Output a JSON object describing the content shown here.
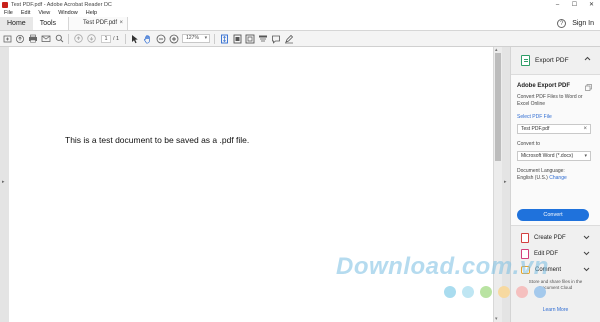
{
  "window": {
    "title": "Test PDF.pdf - Adobe Acrobat Reader DC",
    "controls": [
      "–",
      "☐",
      "✕"
    ]
  },
  "menu": [
    "File",
    "Edit",
    "View",
    "Window",
    "Help"
  ],
  "tabs": {
    "home": "Home",
    "tools": "Tools",
    "document": "Test PDF.pdf",
    "close": "×",
    "help": "?",
    "sign_in": "Sign In"
  },
  "toolbar": {
    "page_current": "1",
    "page_total": "/ 1",
    "zoom": "127%"
  },
  "document": {
    "text": "This is a test document to be saved as a .pdf file."
  },
  "panel": {
    "export_pdf": "Export PDF",
    "card_title": "Adobe Export PDF",
    "card_desc": "Convert PDF Files to Word or Excel Online",
    "select_file": "Select PDF File",
    "file_name": "Test PDF.pdf",
    "convert_to_label": "Convert to",
    "convert_to_value": "Microsoft Word (*.docx)",
    "doc_language_label": "Document Language:",
    "doc_language_value": "English (U.S.)",
    "change": "Change",
    "convert_button": "Convert",
    "create_pdf": "Create PDF",
    "edit_pdf": "Edit PDF",
    "comment": "Comment",
    "cloud_text": "Store and share files in the Document Cloud",
    "learn_more": "Learn More"
  },
  "watermark": {
    "text": "Download.com.vn",
    "dot_colors": [
      "#a9dcef",
      "#bfe6f3",
      "#b9e3a2",
      "#f7d9a0",
      "#f5c0bf",
      "#a4c9ec"
    ]
  },
  "colors": {
    "accent": "#1f72dc",
    "link": "#2d6bd2"
  }
}
